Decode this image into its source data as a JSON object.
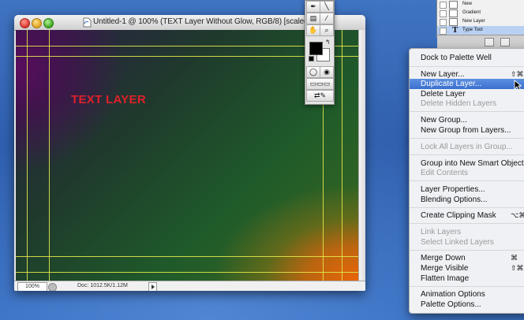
{
  "document": {
    "title": "Untitled-1 @ 100% (TEXT Layer Without Glow, RGB/8) [scaled]",
    "canvas_text": "TEXT LAYER",
    "zoom": "100%",
    "doc_size": "Doc: 1012.5K/1.12M"
  },
  "layers": {
    "rows": [
      {
        "name": "New"
      },
      {
        "name": "Gradient"
      },
      {
        "name": "New Layer"
      },
      {
        "name": "Type Tool"
      }
    ]
  },
  "menu": {
    "items": [
      {
        "label": "Dock to Palette Well",
        "shortcut": "",
        "disabled": false
      },
      {
        "label": "New Layer...",
        "shortcut": "⇧⌘",
        "disabled": false
      },
      {
        "label": "Duplicate Layer...",
        "shortcut": "",
        "disabled": false
      },
      {
        "label": "Delete Layer",
        "shortcut": "",
        "disabled": false
      },
      {
        "label": "Delete Hidden Layers",
        "shortcut": "",
        "disabled": true
      },
      {
        "label": "New Group...",
        "shortcut": "",
        "disabled": false
      },
      {
        "label": "New Group from Layers...",
        "shortcut": "",
        "disabled": false
      },
      {
        "label": "Lock All Layers in Group...",
        "shortcut": "",
        "disabled": true
      },
      {
        "label": "Group into New Smart Object",
        "shortcut": "",
        "disabled": false
      },
      {
        "label": "Edit Contents",
        "shortcut": "",
        "disabled": true
      },
      {
        "label": "Layer Properties...",
        "shortcut": "",
        "disabled": false
      },
      {
        "label": "Blending Options...",
        "shortcut": "",
        "disabled": false
      },
      {
        "label": "Create Clipping Mask",
        "shortcut": "⌥⌘",
        "disabled": false
      },
      {
        "label": "Link Layers",
        "shortcut": "",
        "disabled": true
      },
      {
        "label": "Select Linked Layers",
        "shortcut": "",
        "disabled": true
      },
      {
        "label": "Merge Down",
        "shortcut": "⌘",
        "disabled": false
      },
      {
        "label": "Merge Visible",
        "shortcut": "⇧⌘",
        "disabled": false
      },
      {
        "label": "Flatten Image",
        "shortcut": "",
        "disabled": false
      },
      {
        "label": "Animation Options",
        "shortcut": "",
        "disabled": false
      },
      {
        "label": "Palette Options...",
        "shortcut": "",
        "disabled": false
      }
    ],
    "highlighted": "Duplicate Layer..."
  },
  "colors": {
    "foreground": "#000000",
    "background": "#ffffff",
    "guide": "#e3e84a",
    "text_layer": "#e0202a",
    "menu_highlight": "#3a6fcf"
  }
}
